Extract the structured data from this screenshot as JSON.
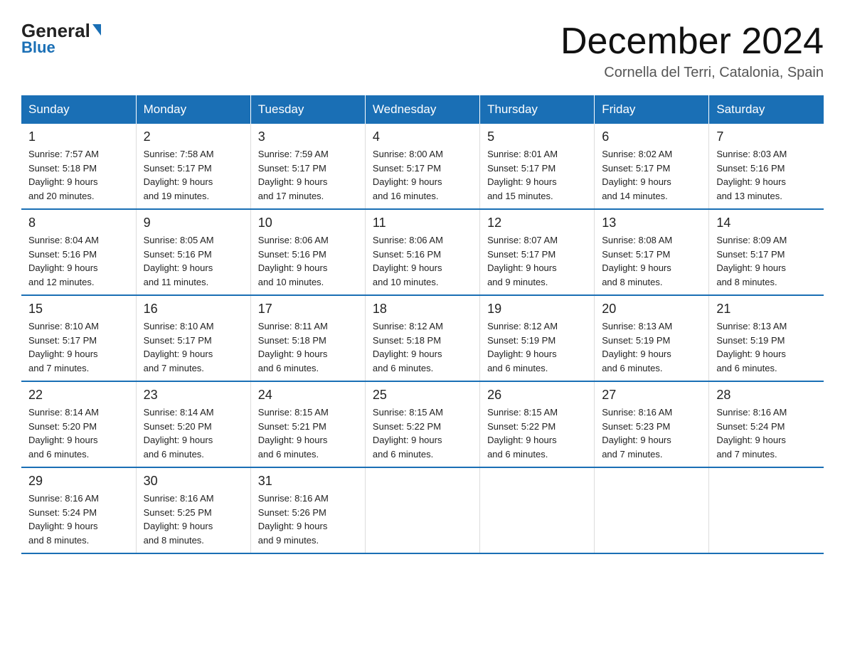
{
  "header": {
    "logo_general": "General",
    "logo_blue": "Blue",
    "title": "December 2024",
    "subtitle": "Cornella del Terri, Catalonia, Spain"
  },
  "days_of_week": [
    "Sunday",
    "Monday",
    "Tuesday",
    "Wednesday",
    "Thursday",
    "Friday",
    "Saturday"
  ],
  "weeks": [
    [
      {
        "day": "1",
        "sunrise": "7:57 AM",
        "sunset": "5:18 PM",
        "daylight": "9 hours and 20 minutes."
      },
      {
        "day": "2",
        "sunrise": "7:58 AM",
        "sunset": "5:17 PM",
        "daylight": "9 hours and 19 minutes."
      },
      {
        "day": "3",
        "sunrise": "7:59 AM",
        "sunset": "5:17 PM",
        "daylight": "9 hours and 17 minutes."
      },
      {
        "day": "4",
        "sunrise": "8:00 AM",
        "sunset": "5:17 PM",
        "daylight": "9 hours and 16 minutes."
      },
      {
        "day": "5",
        "sunrise": "8:01 AM",
        "sunset": "5:17 PM",
        "daylight": "9 hours and 15 minutes."
      },
      {
        "day": "6",
        "sunrise": "8:02 AM",
        "sunset": "5:17 PM",
        "daylight": "9 hours and 14 minutes."
      },
      {
        "day": "7",
        "sunrise": "8:03 AM",
        "sunset": "5:16 PM",
        "daylight": "9 hours and 13 minutes."
      }
    ],
    [
      {
        "day": "8",
        "sunrise": "8:04 AM",
        "sunset": "5:16 PM",
        "daylight": "9 hours and 12 minutes."
      },
      {
        "day": "9",
        "sunrise": "8:05 AM",
        "sunset": "5:16 PM",
        "daylight": "9 hours and 11 minutes."
      },
      {
        "day": "10",
        "sunrise": "8:06 AM",
        "sunset": "5:16 PM",
        "daylight": "9 hours and 10 minutes."
      },
      {
        "day": "11",
        "sunrise": "8:06 AM",
        "sunset": "5:16 PM",
        "daylight": "9 hours and 10 minutes."
      },
      {
        "day": "12",
        "sunrise": "8:07 AM",
        "sunset": "5:17 PM",
        "daylight": "9 hours and 9 minutes."
      },
      {
        "day": "13",
        "sunrise": "8:08 AM",
        "sunset": "5:17 PM",
        "daylight": "9 hours and 8 minutes."
      },
      {
        "day": "14",
        "sunrise": "8:09 AM",
        "sunset": "5:17 PM",
        "daylight": "9 hours and 8 minutes."
      }
    ],
    [
      {
        "day": "15",
        "sunrise": "8:10 AM",
        "sunset": "5:17 PM",
        "daylight": "9 hours and 7 minutes."
      },
      {
        "day": "16",
        "sunrise": "8:10 AM",
        "sunset": "5:17 PM",
        "daylight": "9 hours and 7 minutes."
      },
      {
        "day": "17",
        "sunrise": "8:11 AM",
        "sunset": "5:18 PM",
        "daylight": "9 hours and 6 minutes."
      },
      {
        "day": "18",
        "sunrise": "8:12 AM",
        "sunset": "5:18 PM",
        "daylight": "9 hours and 6 minutes."
      },
      {
        "day": "19",
        "sunrise": "8:12 AM",
        "sunset": "5:19 PM",
        "daylight": "9 hours and 6 minutes."
      },
      {
        "day": "20",
        "sunrise": "8:13 AM",
        "sunset": "5:19 PM",
        "daylight": "9 hours and 6 minutes."
      },
      {
        "day": "21",
        "sunrise": "8:13 AM",
        "sunset": "5:19 PM",
        "daylight": "9 hours and 6 minutes."
      }
    ],
    [
      {
        "day": "22",
        "sunrise": "8:14 AM",
        "sunset": "5:20 PM",
        "daylight": "9 hours and 6 minutes."
      },
      {
        "day": "23",
        "sunrise": "8:14 AM",
        "sunset": "5:20 PM",
        "daylight": "9 hours and 6 minutes."
      },
      {
        "day": "24",
        "sunrise": "8:15 AM",
        "sunset": "5:21 PM",
        "daylight": "9 hours and 6 minutes."
      },
      {
        "day": "25",
        "sunrise": "8:15 AM",
        "sunset": "5:22 PM",
        "daylight": "9 hours and 6 minutes."
      },
      {
        "day": "26",
        "sunrise": "8:15 AM",
        "sunset": "5:22 PM",
        "daylight": "9 hours and 6 minutes."
      },
      {
        "day": "27",
        "sunrise": "8:16 AM",
        "sunset": "5:23 PM",
        "daylight": "9 hours and 7 minutes."
      },
      {
        "day": "28",
        "sunrise": "8:16 AM",
        "sunset": "5:24 PM",
        "daylight": "9 hours and 7 minutes."
      }
    ],
    [
      {
        "day": "29",
        "sunrise": "8:16 AM",
        "sunset": "5:24 PM",
        "daylight": "9 hours and 8 minutes."
      },
      {
        "day": "30",
        "sunrise": "8:16 AM",
        "sunset": "5:25 PM",
        "daylight": "9 hours and 8 minutes."
      },
      {
        "day": "31",
        "sunrise": "8:16 AM",
        "sunset": "5:26 PM",
        "daylight": "9 hours and 9 minutes."
      },
      {
        "day": "",
        "sunrise": "",
        "sunset": "",
        "daylight": ""
      },
      {
        "day": "",
        "sunrise": "",
        "sunset": "",
        "daylight": ""
      },
      {
        "day": "",
        "sunrise": "",
        "sunset": "",
        "daylight": ""
      },
      {
        "day": "",
        "sunrise": "",
        "sunset": "",
        "daylight": ""
      }
    ]
  ],
  "labels": {
    "sunrise": "Sunrise:",
    "sunset": "Sunset:",
    "daylight": "Daylight:"
  }
}
